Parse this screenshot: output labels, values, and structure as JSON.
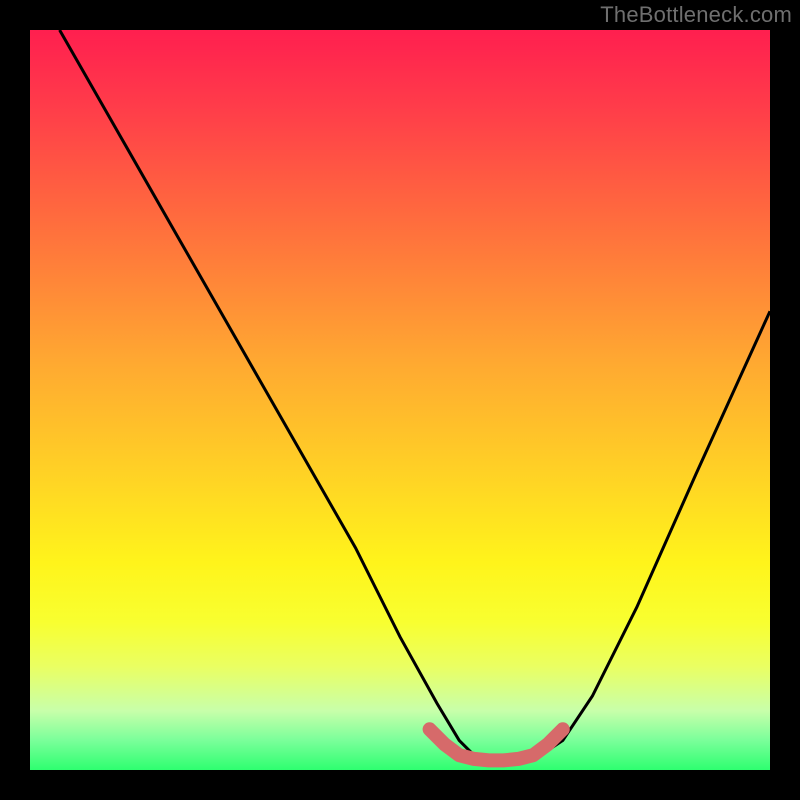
{
  "watermark": "TheBottleneck.com",
  "chart_data": {
    "type": "line",
    "title": "",
    "xlabel": "",
    "ylabel": "",
    "xlim": [
      0,
      100
    ],
    "ylim": [
      0,
      100
    ],
    "series": [
      {
        "name": "curve-black",
        "stroke": "#000000",
        "x": [
          4,
          12,
          20,
          28,
          36,
          44,
          50,
          55,
          58,
          60,
          63,
          66,
          69,
          72,
          76,
          82,
          90,
          100
        ],
        "y": [
          100,
          86,
          72,
          58,
          44,
          30,
          18,
          9,
          4,
          2,
          1.5,
          1.5,
          2,
          4,
          10,
          22,
          40,
          62
        ]
      },
      {
        "name": "curve-pink-bottom",
        "stroke": "#d66a6a",
        "x": [
          54,
          56,
          58,
          60,
          62,
          64,
          66,
          68,
          70,
          72
        ],
        "y": [
          5.5,
          3.5,
          2,
          1.5,
          1.3,
          1.3,
          1.5,
          2,
          3.5,
          5.5
        ]
      }
    ],
    "gradient_stops": [
      {
        "pos": 0.0,
        "color": "#ff1f4f"
      },
      {
        "pos": 0.1,
        "color": "#ff3b4a"
      },
      {
        "pos": 0.25,
        "color": "#ff6a3e"
      },
      {
        "pos": 0.45,
        "color": "#ffa931"
      },
      {
        "pos": 0.6,
        "color": "#ffd225"
      },
      {
        "pos": 0.72,
        "color": "#fff41b"
      },
      {
        "pos": 0.8,
        "color": "#f8ff30"
      },
      {
        "pos": 0.86,
        "color": "#eaff62"
      },
      {
        "pos": 0.92,
        "color": "#c8ffaa"
      },
      {
        "pos": 0.96,
        "color": "#7aff9a"
      },
      {
        "pos": 1.0,
        "color": "#2eff70"
      }
    ]
  }
}
